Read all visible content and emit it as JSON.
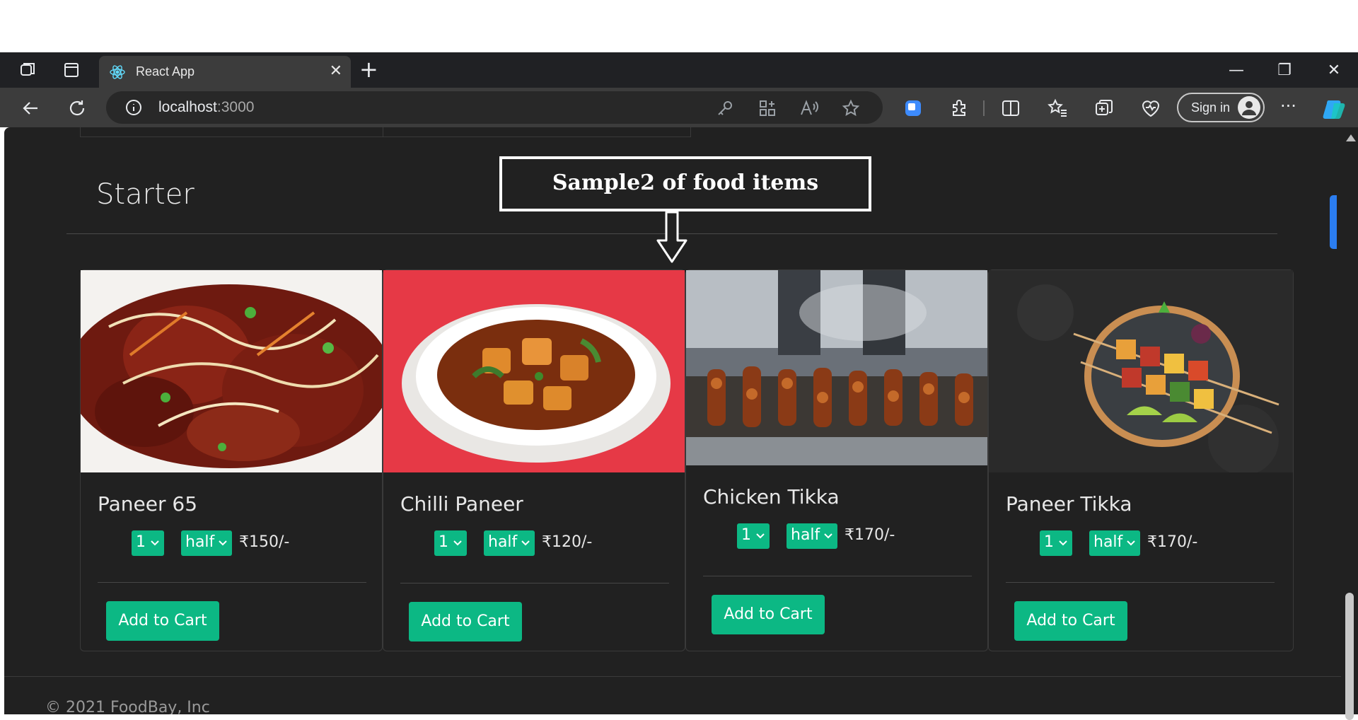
{
  "browser": {
    "tab_title": "React App",
    "tab_close": "✕",
    "new_tab": "+",
    "url_host": "localhost",
    "url_port": ":3000",
    "signin_label": "Sign in",
    "more_label": "···",
    "window_controls": {
      "minimize": "—",
      "restore": "❐",
      "close": "✕"
    },
    "icons": [
      "workspaces-icon",
      "tab-actions-icon",
      "react-favicon-icon",
      "back-icon",
      "refresh-icon",
      "info-icon",
      "key-icon",
      "app-available-icon",
      "read-aloud-icon",
      "favorite-star-icon",
      "extension-blue-icon",
      "extensions-icon",
      "split-screen-icon",
      "favorites-icon",
      "collections-icon",
      "browser-essentials-icon",
      "copilot-icon"
    ]
  },
  "page": {
    "section_title": "Starter",
    "annotation": "Sample2 of food items",
    "footer": "© 2021 FoodBay, Inc",
    "accent_color": "#0cb884",
    "items": [
      {
        "name": "Paneer 65",
        "qty": "1",
        "size": "half",
        "price": "₹150/-",
        "button": "Add to Cart"
      },
      {
        "name": "Chilli Paneer",
        "qty": "1",
        "size": "half",
        "price": "₹120/-",
        "button": "Add to Cart"
      },
      {
        "name": "Chicken Tikka",
        "qty": "1",
        "size": "half",
        "price": "₹170/-",
        "button": "Add to Cart"
      },
      {
        "name": "Paneer Tikka",
        "qty": "1",
        "size": "half",
        "price": "₹170/-",
        "button": "Add to Cart"
      }
    ]
  }
}
